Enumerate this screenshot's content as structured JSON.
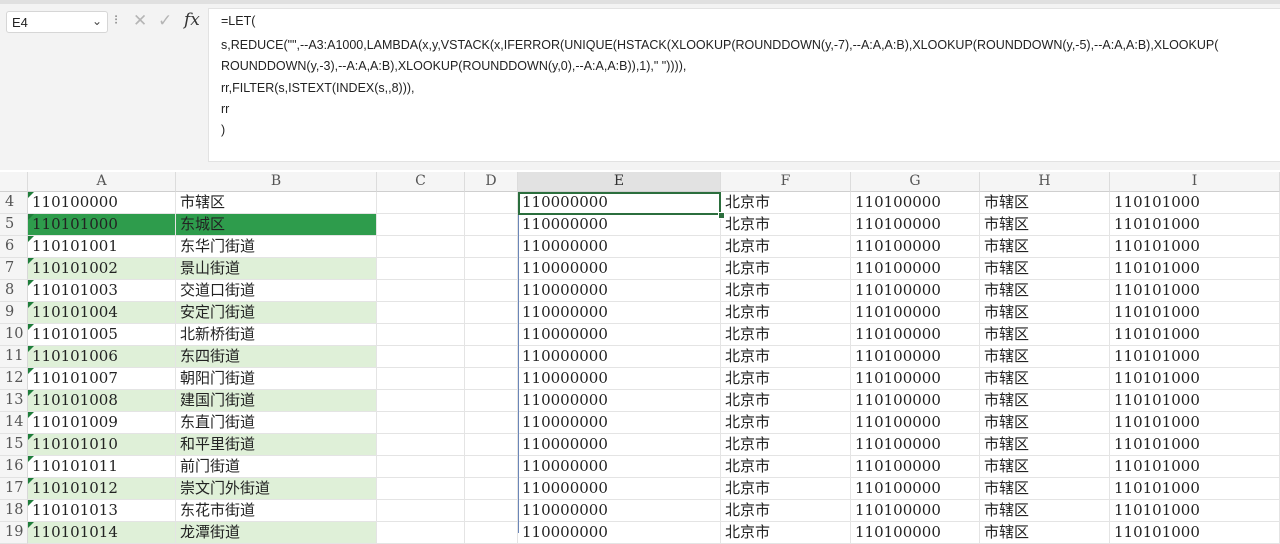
{
  "name_box": {
    "value": "E4"
  },
  "formula_bar": {
    "fx_label": "fx",
    "lines": [
      "=LET(",
      "s,REDUCE(\"\",--A3:A1000,LAMBDA(x,y,VSTACK(x,IFERROR(UNIQUE(HSTACK(XLOOKUP(ROUNDDOWN(y,-7),--A:A,A:B),XLOOKUP(ROUNDDOWN(y,-5),--A:A,A:B),XLOOKUP(",
      "ROUNDDOWN(y,-3),--A:A,A:B),XLOOKUP(ROUNDDOWN(y,0),--A:A,A:B)),1),\" \")))),",
      "rr,FILTER(s,ISTEXT(INDEX(s,,8))),",
      "rr",
      ")"
    ]
  },
  "columns": [
    "A",
    "B",
    "C",
    "D",
    "E",
    "F",
    "G",
    "H",
    "I"
  ],
  "colors": {
    "selected_fill": "#2e9c4c",
    "light_fill": "#dff0d8",
    "active_border": "#2b6e3d"
  },
  "rows": [
    {
      "num": "4",
      "a": "110100000",
      "b": "市辖区",
      "fill": "none",
      "e": "110000000",
      "f": "北京市",
      "g": "110100000",
      "h": "市辖区",
      "i": "110101000"
    },
    {
      "num": "5",
      "a": "110101000",
      "b": "东城区",
      "fill": "dark",
      "e": "110000000",
      "f": "北京市",
      "g": "110100000",
      "h": "市辖区",
      "i": "110101000"
    },
    {
      "num": "6",
      "a": "110101001",
      "b": "东华门街道",
      "fill": "none",
      "e": "110000000",
      "f": "北京市",
      "g": "110100000",
      "h": "市辖区",
      "i": "110101000"
    },
    {
      "num": "7",
      "a": "110101002",
      "b": "景山街道",
      "fill": "light",
      "e": "110000000",
      "f": "北京市",
      "g": "110100000",
      "h": "市辖区",
      "i": "110101000"
    },
    {
      "num": "8",
      "a": "110101003",
      "b": "交道口街道",
      "fill": "none",
      "e": "110000000",
      "f": "北京市",
      "g": "110100000",
      "h": "市辖区",
      "i": "110101000"
    },
    {
      "num": "9",
      "a": "110101004",
      "b": "安定门街道",
      "fill": "light",
      "e": "110000000",
      "f": "北京市",
      "g": "110100000",
      "h": "市辖区",
      "i": "110101000"
    },
    {
      "num": "10",
      "a": "110101005",
      "b": "北新桥街道",
      "fill": "none",
      "e": "110000000",
      "f": "北京市",
      "g": "110100000",
      "h": "市辖区",
      "i": "110101000"
    },
    {
      "num": "11",
      "a": "110101006",
      "b": "东四街道",
      "fill": "light",
      "e": "110000000",
      "f": "北京市",
      "g": "110100000",
      "h": "市辖区",
      "i": "110101000"
    },
    {
      "num": "12",
      "a": "110101007",
      "b": "朝阳门街道",
      "fill": "none",
      "e": "110000000",
      "f": "北京市",
      "g": "110100000",
      "h": "市辖区",
      "i": "110101000"
    },
    {
      "num": "13",
      "a": "110101008",
      "b": "建国门街道",
      "fill": "light",
      "e": "110000000",
      "f": "北京市",
      "g": "110100000",
      "h": "市辖区",
      "i": "110101000"
    },
    {
      "num": "14",
      "a": "110101009",
      "b": "东直门街道",
      "fill": "none",
      "e": "110000000",
      "f": "北京市",
      "g": "110100000",
      "h": "市辖区",
      "i": "110101000"
    },
    {
      "num": "15",
      "a": "110101010",
      "b": "和平里街道",
      "fill": "light",
      "e": "110000000",
      "f": "北京市",
      "g": "110100000",
      "h": "市辖区",
      "i": "110101000"
    },
    {
      "num": "16",
      "a": "110101011",
      "b": "前门街道",
      "fill": "none",
      "e": "110000000",
      "f": "北京市",
      "g": "110100000",
      "h": "市辖区",
      "i": "110101000"
    },
    {
      "num": "17",
      "a": "110101012",
      "b": "崇文门外街道",
      "fill": "light",
      "e": "110000000",
      "f": "北京市",
      "g": "110100000",
      "h": "市辖区",
      "i": "110101000"
    },
    {
      "num": "18",
      "a": "110101013",
      "b": "东花市街道",
      "fill": "none",
      "e": "110000000",
      "f": "北京市",
      "g": "110100000",
      "h": "市辖区",
      "i": "110101000"
    },
    {
      "num": "19",
      "a": "110101014",
      "b": "龙潭街道",
      "fill": "light",
      "e": "110000000",
      "f": "北京市",
      "g": "110100000",
      "h": "市辖区",
      "i": "110101000"
    }
  ]
}
